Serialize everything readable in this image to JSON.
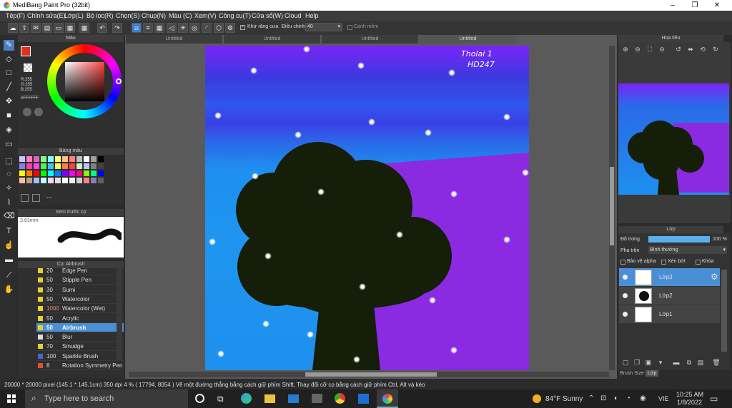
{
  "window": {
    "title": "MediBang Paint Pro (32bit)",
    "min": "–",
    "max": "❐",
    "close": "✕"
  },
  "menu": [
    "Tệp(F)",
    "Chỉnh sửa(E)",
    "Lớp(L)",
    "Bộ lọc(R)",
    "Chọn(S)",
    "Chụp(N)",
    "Màu (C)",
    "Xem(V)",
    "Công cụ(T)",
    "Cửa sổ(W)",
    "Cloud",
    "Help"
  ],
  "toolbar": {
    "antialias_label": "Khử răng cưa",
    "adjust_label": "Điều chỉnh",
    "adjust_value": "40",
    "soft_label": "Cạnh mềm"
  },
  "tabs": [
    "Untitled",
    "Untitled",
    "Untitled",
    "Untitled"
  ],
  "color_panel": {
    "title": "Màu",
    "r": "R:255",
    "g": "G:255",
    "b": "B:255",
    "hex": "#FFFFFF"
  },
  "palette_panel": {
    "title": "Bảng màu",
    "dash": "---"
  },
  "brush_preview": {
    "title": "Xem trước cọ",
    "size": "3.63mm"
  },
  "brush_panel": {
    "title": "Cọ: Airbrush",
    "items": [
      {
        "size": "20",
        "name": "Edge Pen",
        "color": "#e8d030"
      },
      {
        "size": "50",
        "name": "Stipple Pen",
        "color": "#e8d030"
      },
      {
        "size": "30",
        "name": "Sumi",
        "color": "#e8d030"
      },
      {
        "size": "50",
        "name": "Watercolor",
        "color": "#e8d030"
      },
      {
        "size": "1000",
        "name": "Watercolor (Wet)",
        "color": "#e8d030"
      },
      {
        "size": "50",
        "name": "Acrylic",
        "color": "#e8d030"
      },
      {
        "size": "50",
        "name": "Airbrush",
        "color": "#e8d030"
      },
      {
        "size": "50",
        "name": "Blur",
        "color": "#ddd"
      },
      {
        "size": "70",
        "name": "Smudge",
        "color": "#e8d030"
      },
      {
        "size": "100",
        "name": "Sparkle Brush",
        "color": "#3a6fd0"
      },
      {
        "size": "8",
        "name": "Rotation Symmetry Pen",
        "color": "#e05030"
      }
    ]
  },
  "artwork": {
    "sig1": "Tholai 1",
    "sig2": "HD247"
  },
  "navigator": {
    "title": "Hoa tiêu"
  },
  "layer_panel": {
    "title": "Lớp",
    "opacity_label": "Độ trong",
    "opacity_value": "100 %",
    "blend_label": "Pha trộn",
    "blend_value": "Bình thường",
    "protect_alpha": "Bảo vệ alpha",
    "clipping": "Xén bớt",
    "lock": "Khóa",
    "layers": [
      "Lớp3",
      "Lớp2",
      "Lớp1"
    ]
  },
  "bottom_tabs": {
    "brush_size": "Brush Size",
    "layer": "Lớp"
  },
  "status": {
    "text": "20000 * 20000 pixel   (145.1 * 145.1cm)   350 dpi   4 %   ( 17794, 8054 )   Vẽ một đường thẳng bằng cách giữ phím Shift, Thay đổi cỡ cọ bằng cách giữ phím Ctrl, Alt và kéo"
  },
  "taskbar": {
    "search": "Type here to search",
    "weather": "84°F  Sunny",
    "lang": "VIE",
    "time": "10:25 AM",
    "date": "1/8/2022"
  },
  "colors": {
    "accent": "#4a8fd4",
    "canvas_purple": "#8a2be2",
    "canvas_blue": "#1e90ee"
  }
}
